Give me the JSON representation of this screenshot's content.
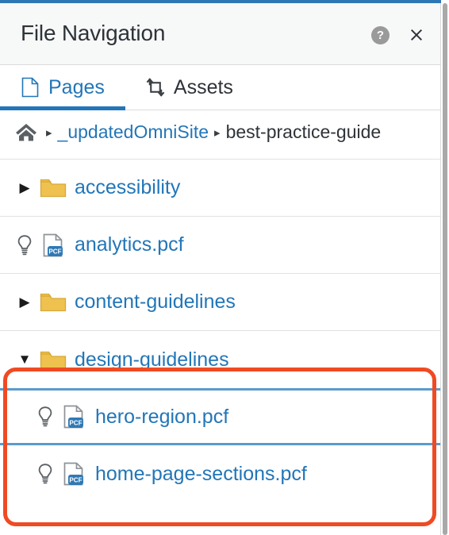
{
  "window": {
    "title": "File Navigation",
    "accent_color": "#2d78b4",
    "help_icon_label": "?",
    "close_icon_label": "✕"
  },
  "tabs": [
    {
      "label": "Pages",
      "icon": "page-icon",
      "active": true
    },
    {
      "label": "Assets",
      "icon": "transfer-arrows-icon",
      "active": false
    }
  ],
  "breadcrumb": {
    "home_icon": "home-icon",
    "separator": "▸",
    "items": [
      {
        "label": "_updatedOmniSite",
        "current": false
      },
      {
        "label": "best-practice-guide",
        "current": true
      }
    ]
  },
  "tree": {
    "rows": [
      {
        "label": "accessibility",
        "type": "folder",
        "expanded": false,
        "twisty": "▶",
        "has_bulb": false,
        "highlight": false
      },
      {
        "label": "analytics.pcf",
        "type": "file",
        "badge": "PCF",
        "twisty": "",
        "has_bulb": true,
        "highlight": false
      },
      {
        "label": "content-guidelines",
        "type": "folder",
        "expanded": false,
        "twisty": "▶",
        "has_bulb": false,
        "highlight": false
      },
      {
        "label": "design-guidelines",
        "type": "folder",
        "expanded": true,
        "twisty": "▼",
        "has_bulb": false,
        "highlight": false
      },
      {
        "label": "hero-region.pcf",
        "type": "file",
        "badge": "PCF",
        "twisty": "",
        "has_bulb": true,
        "highlight": true
      },
      {
        "label": "home-page-sections.pcf",
        "type": "file",
        "badge": "PCF",
        "twisty": "",
        "has_bulb": true,
        "highlight": false
      }
    ]
  },
  "annotation": {
    "shape": "rounded-rectangle",
    "color": "#f04a23"
  },
  "colors": {
    "link": "#2276b8",
    "folder": "#efc14e",
    "badge": "#2f79b5",
    "highlight_border": "#5b9bcd",
    "text": "#2e3338"
  }
}
